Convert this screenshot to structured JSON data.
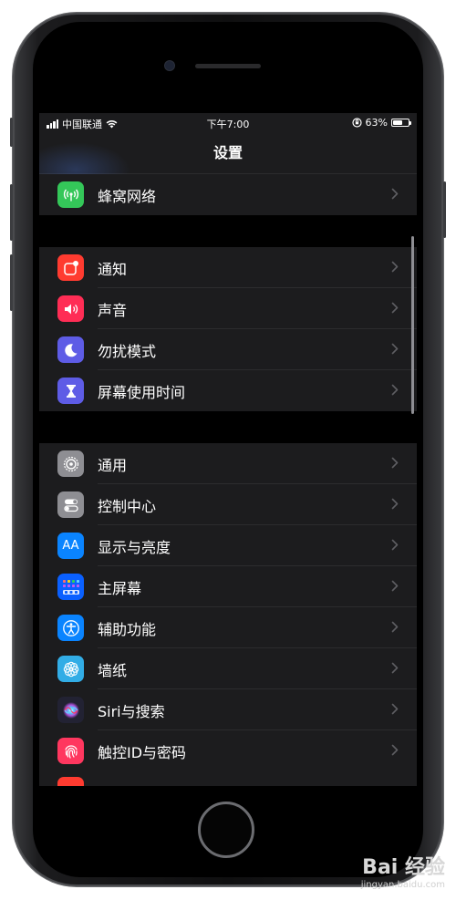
{
  "status": {
    "carrier": "中国联通",
    "time": "下午7:00",
    "battery_pct": "63%",
    "battery_level": 0.63
  },
  "nav": {
    "title": "设置"
  },
  "groups": [
    {
      "items": [
        {
          "label": "蜂窝网络",
          "icon": "antenna-icon",
          "color": "#34c759"
        }
      ]
    },
    {
      "items": [
        {
          "label": "通知",
          "icon": "notification-icon",
          "color": "#ff3b30"
        },
        {
          "label": "声音",
          "icon": "speaker-icon",
          "color": "#ff2d55"
        },
        {
          "label": "勿扰模式",
          "icon": "moon-icon",
          "color": "#5e5ce6"
        },
        {
          "label": "屏幕使用时间",
          "icon": "hourglass-icon",
          "color": "#5e5ce6"
        }
      ]
    },
    {
      "items": [
        {
          "label": "通用",
          "icon": "gear-icon",
          "color": "#8e8e93"
        },
        {
          "label": "控制中心",
          "icon": "toggles-icon",
          "color": "#8e8e93"
        },
        {
          "label": "显示与亮度",
          "icon": "text-size-icon",
          "color": "#0a84ff"
        },
        {
          "label": "主屏幕",
          "icon": "home-grid-icon",
          "color": "#0a60ff"
        },
        {
          "label": "辅助功能",
          "icon": "accessibility-icon",
          "color": "#0a84ff"
        },
        {
          "label": "墙纸",
          "icon": "flower-icon",
          "color": "#32ade6"
        },
        {
          "label": "Siri与搜索",
          "icon": "siri-icon",
          "color": "#222233"
        },
        {
          "label": "触控ID与密码",
          "icon": "fingerprint-icon",
          "color": "#ff375f"
        }
      ]
    }
  ],
  "icon_glyphs": {
    "display": "AA"
  },
  "watermark": {
    "brand": "Bai 经验",
    "url": "jingyan.baidu.com"
  }
}
